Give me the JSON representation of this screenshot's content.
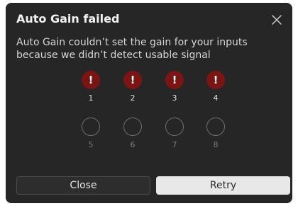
{
  "dialog": {
    "title": "Auto Gain failed",
    "close_icon": "close-icon",
    "message": "Auto Gain couldn’t set the gain for your inputs because we didn’t detect usable signal",
    "channels": [
      {
        "label": "1",
        "status": "error",
        "glyph": "!"
      },
      {
        "label": "2",
        "status": "error",
        "glyph": "!"
      },
      {
        "label": "3",
        "status": "error",
        "glyph": "!"
      },
      {
        "label": "4",
        "status": "error",
        "glyph": "!"
      },
      {
        "label": "5",
        "status": "inactive"
      },
      {
        "label": "6",
        "status": "inactive"
      },
      {
        "label": "7",
        "status": "inactive"
      },
      {
        "label": "8",
        "status": "inactive"
      }
    ],
    "buttons": {
      "close_label": "Close",
      "retry_label": "Retry"
    }
  },
  "colors": {
    "background": "#262626",
    "error": "#7c1414",
    "retry_button": "#e8e8e8"
  }
}
